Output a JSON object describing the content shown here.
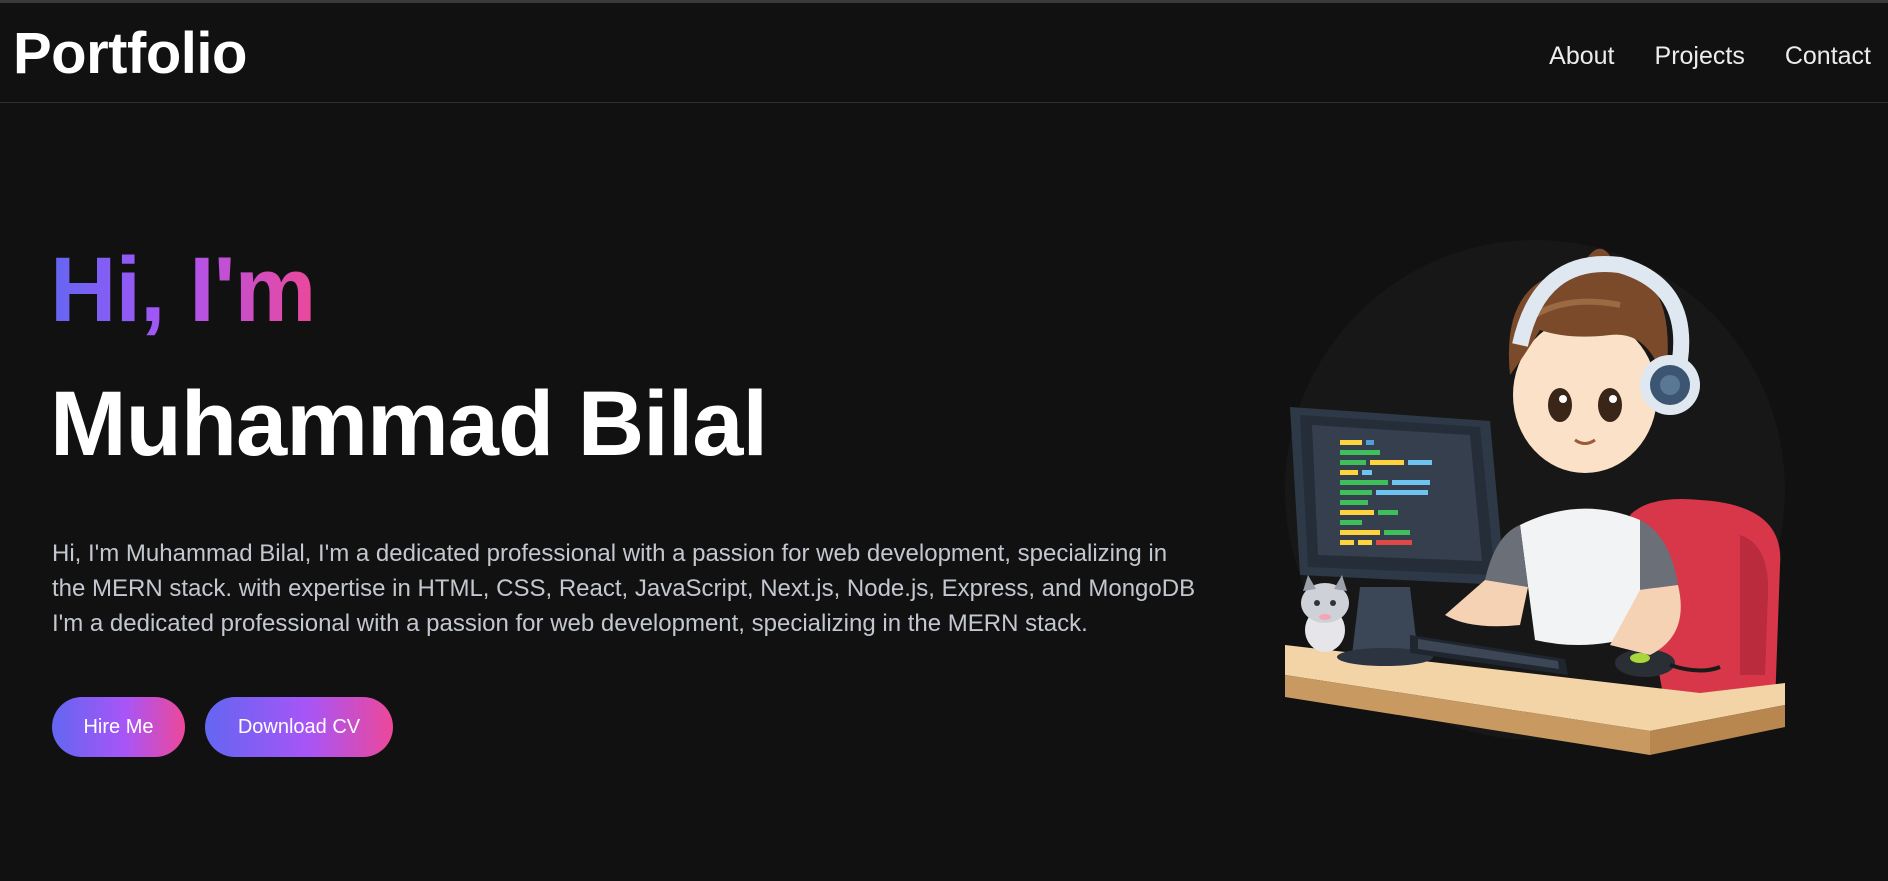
{
  "header": {
    "logo": "Portfolio",
    "nav": [
      {
        "label": "About"
      },
      {
        "label": "Projects"
      },
      {
        "label": "Contact"
      }
    ]
  },
  "hero": {
    "greeting": "Hi, I'm",
    "name": "Muhammad Bilal",
    "description": "Hi, I'm Muhammad Bilal, I'm a dedicated professional with a passion for web development, specializing in the MERN stack. with expertise in HTML, CSS, React, JavaScript, Next.js, Node.js, Express, and MongoDB I'm a dedicated professional with a passion for web development, specializing in the MERN stack.",
    "hire_label": "Hire Me",
    "cv_label": "Download CV"
  },
  "illustration": {
    "icon": "developer-avatar-illustration"
  },
  "colors": {
    "background": "#111111",
    "gradient_start": "#6366f1",
    "gradient_mid": "#a855f7",
    "gradient_end": "#ec4899",
    "body_text": "#c3c7cf"
  }
}
